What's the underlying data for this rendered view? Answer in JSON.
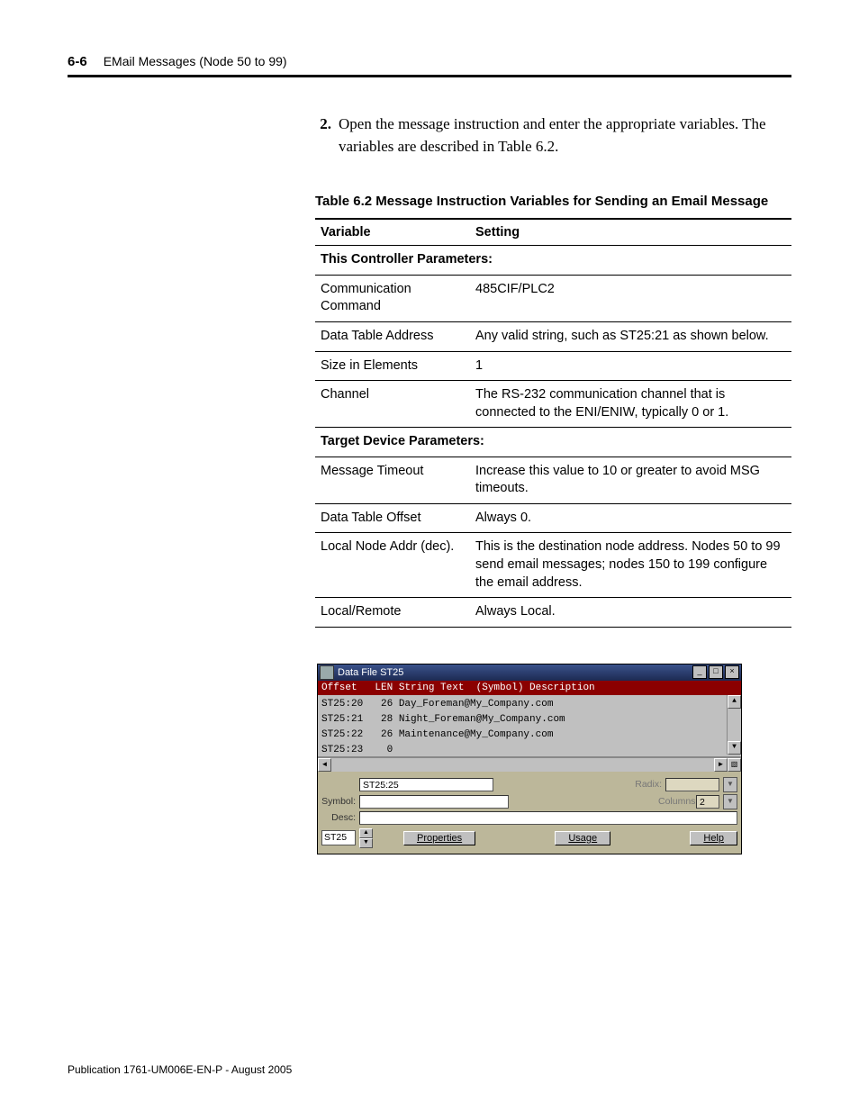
{
  "header": {
    "page_no": "6-6",
    "title": "EMail Messages (Node 50 to 99)"
  },
  "step": {
    "num": "2.",
    "text": "Open the message instruction and enter the appropriate variables. The variables are described in Table 6.2."
  },
  "table": {
    "caption": "Table 6.2 Message Instruction Variables for Sending an Email Message",
    "head_var": "Variable",
    "head_set": "Setting",
    "section1": "This Controller Parameters:",
    "rows1": [
      {
        "v": "Communication Command",
        "s": "485CIF/PLC2"
      },
      {
        "v": "Data Table Address",
        "s": "Any valid string, such as ST25:21 as shown below."
      },
      {
        "v": "Size in Elements",
        "s": "1"
      },
      {
        "v": "Channel",
        "s": "The RS-232 communication channel that is connected to the ENI/ENIW, typically 0 or 1."
      }
    ],
    "section2": "Target Device Parameters:",
    "rows2": [
      {
        "v": "Message Timeout",
        "s": "Increase this value to 10 or greater to avoid MSG timeouts."
      },
      {
        "v": "Data Table Offset",
        "s": "Always 0."
      },
      {
        "v": "Local Node Addr (dec).",
        "s": "This is the destination node address. Nodes 50 to 99 send email messages; nodes 150 to 199 configure the email address."
      },
      {
        "v": "Local/Remote",
        "s": "Always Local."
      }
    ]
  },
  "appwin": {
    "title": "Data File ST25",
    "colhead": "Offset   LEN String Text  (Symbol) Description",
    "rows": [
      "ST25:20   26 Day_Foreman@My_Company.com",
      "ST25:21   28 Night_Foreman@My_Company.com",
      "ST25:22   26 Maintenance@My_Company.com",
      "ST25:23    0"
    ],
    "nav_field": "ST25:25",
    "radix_lbl": "Radix:",
    "symbol_lbl": "Symbol:",
    "columns_lbl": "Columns:",
    "columns_val": "2",
    "desc_lbl": "Desc:",
    "file_field": "ST25",
    "btn_props": "Properties",
    "btn_usage": "Usage",
    "btn_help": "Help"
  },
  "footer": "Publication 1761-UM006E-EN-P - August 2005"
}
